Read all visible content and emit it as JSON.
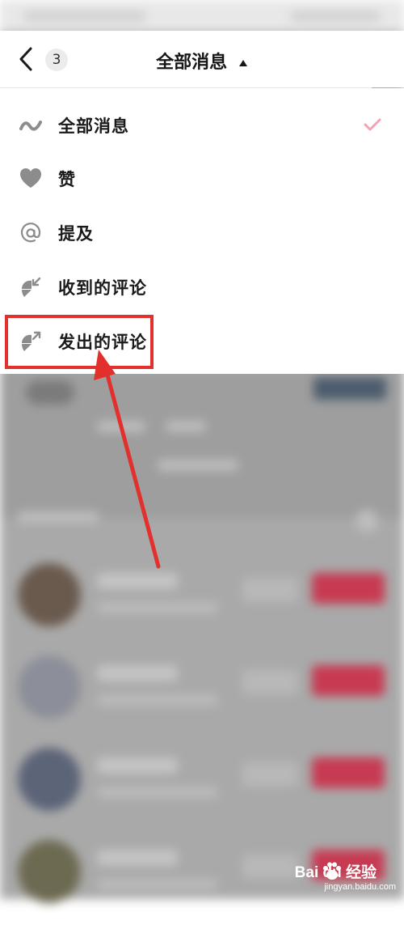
{
  "header": {
    "title": "全部消息",
    "count": "3"
  },
  "menu": {
    "items": [
      {
        "label": "全部消息",
        "icon": "wave-icon",
        "selected": true
      },
      {
        "label": "赞",
        "icon": "heart-icon",
        "selected": false
      },
      {
        "label": "提及",
        "icon": "at-icon",
        "selected": false
      },
      {
        "label": "收到的评论",
        "icon": "comment-received-icon",
        "selected": false
      },
      {
        "label": "发出的评论",
        "icon": "comment-sent-icon",
        "selected": false
      }
    ]
  },
  "watermark": {
    "brand": "Bai du 经验",
    "url": "jingyan.baidu.com"
  },
  "colors": {
    "check": "#f4a3b4",
    "highlight": "#e2312d",
    "accent_button": "#c73a52"
  }
}
